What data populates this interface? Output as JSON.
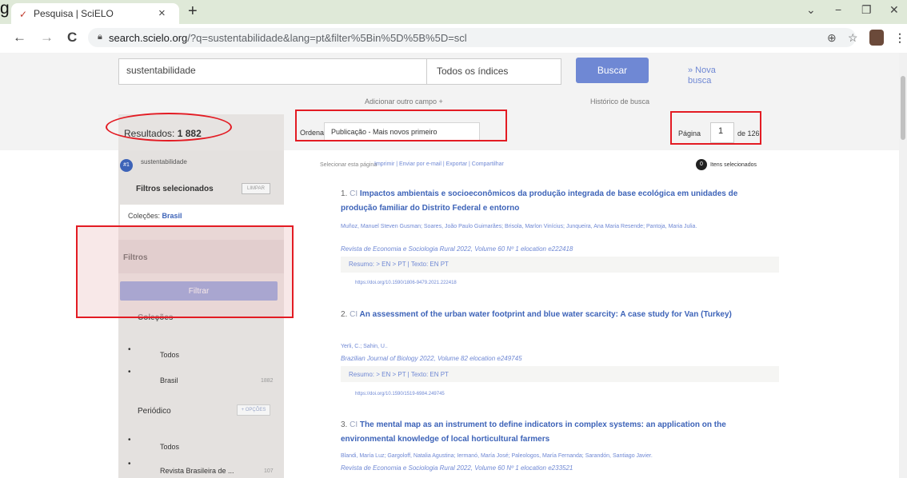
{
  "figure_label": "g",
  "browser": {
    "tab_title": "Pesquisa | SciELO",
    "tab_close": "×",
    "new_tab": "+",
    "url_host": "search.scielo.org",
    "url_rest": "/?q=sustentabilidade&lang=pt&filter%5Bin%5D%5B%5D=scl",
    "back_icon": "←",
    "forward_icon": "→",
    "reload_icon": "C",
    "minimize_icon": "−",
    "restore_icon": "❐",
    "close_icon": "✕",
    "chevron_icon": "⌄"
  },
  "search": {
    "query": "sustentabilidade",
    "index": "Todos os índices",
    "button": "Buscar",
    "new_search_line1": "» Nova",
    "new_search_line2": "busca",
    "add_field": "Adicionar outro campo +",
    "history": "Histórico de busca"
  },
  "results_bar": {
    "results_label": "Resultados:",
    "results_count": "1 882",
    "sort_label": "Ordenar por",
    "sort_value": "Publicação - Mais novos primeiro",
    "page_label": "Página",
    "page_value": "1",
    "page_total": "de 126"
  },
  "sidebar": {
    "search_badge": "#1",
    "search_term": "sustentabilidade",
    "selected_filters": "Filtros selecionados",
    "clear": "LIMPAR",
    "collection_label": "Coleções:",
    "collection_value": "Brasil",
    "filters": "Filtros",
    "filter_button": "Filtrar",
    "collections_section": "Coleções",
    "collections": [
      {
        "label": "Todos",
        "count": ""
      },
      {
        "label": "Brasil",
        "count": "1882"
      }
    ],
    "periodical_section": "Periódico",
    "options": "+ OPÇÕES",
    "periodicals": [
      {
        "label": "Todos",
        "count": ""
      },
      {
        "label": "Revista Brasileira de ...",
        "count": "107"
      }
    ]
  },
  "list_header": {
    "select_page": "Selecionar esta página",
    "actions": "Imprimir | Enviar por e-mail | Exportar | Compartilhar",
    "selected_count": "0",
    "selected_label": "Itens selecionados"
  },
  "results": [
    {
      "num": "1.",
      "ci": "CI",
      "title": "Impactos ambientais e socioeconômicos da produção integrada de base ecológica em unidades de produção familiar do Distrito Federal e entorno",
      "authors": "Muñoz, Manuel Steven Gusman; Soares, João Paulo Guimarães; Brisola, Marlon Vinícius; Junqueira, Ana Maria Resende; Pantoja, Maria Julia.",
      "journal": "Revista de Economia e Sociologia Rural 2022, Volume 60    Nº 1    elocation e222418",
      "links": "Resumo: > EN  > PT  |  Texto: EN  PT",
      "doi": "https://doi.org/10.1590/1806-9479.2021.222418"
    },
    {
      "num": "2.",
      "ci": "CI",
      "title": "An assessment of the urban water footprint and blue water scarcity: A case study for Van (Turkey)",
      "authors": "Yerli, C.; Sahin, U..",
      "journal": "Brazilian Journal of Biology 2022, Volume 82    elocation e249745",
      "links": "Resumo: > EN  > PT  |  Texto: EN  PT",
      "doi": "https://doi.org/10.1590/1519-6984.249745"
    },
    {
      "num": "3.",
      "ci": "CI",
      "title": "The mental map as an instrument to define indicators in complex systems: an application on the environmental knowledge of local horticultural farmers",
      "authors": "Blandi, María Luz; Gargoloff, Natalia Agustina; Iermanó, María José; Paleologos, María Fernanda; Sarandón, Santiago Javier.",
      "journal": "Revista de Economia e Sociologia Rural 2022, Volume 60    Nº 1    elocation e233521"
    }
  ],
  "colors": {
    "accent": "#6f88d4",
    "highlight": "#e31b23",
    "link": "#3d63b8"
  }
}
